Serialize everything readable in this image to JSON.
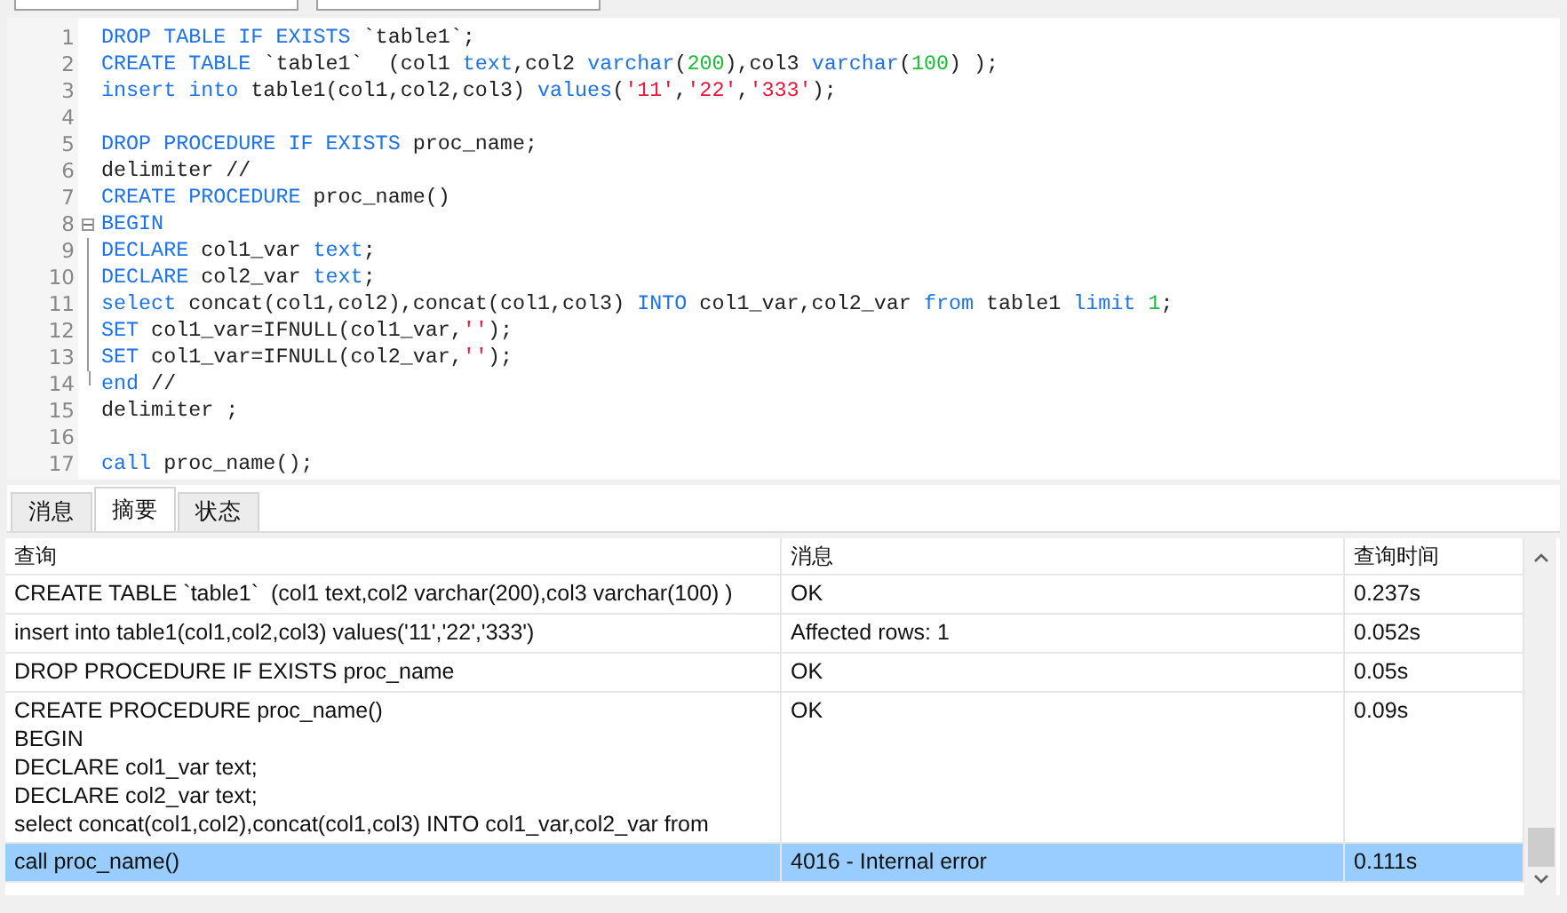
{
  "editor": {
    "lines": [
      {
        "number": "1",
        "tokens": [
          {
            "kind": "kw",
            "text": "DROP TABLE IF EXISTS"
          },
          {
            "kind": "plain",
            "text": " `table1`;"
          }
        ]
      },
      {
        "number": "2",
        "tokens": [
          {
            "kind": "kw",
            "text": "CREATE TABLE"
          },
          {
            "kind": "plain",
            "text": " `table1`  (col1 "
          },
          {
            "kind": "kw",
            "text": "text"
          },
          {
            "kind": "plain",
            "text": ",col2 "
          },
          {
            "kind": "kw",
            "text": "varchar"
          },
          {
            "kind": "plain",
            "text": "("
          },
          {
            "kind": "num",
            "text": "200"
          },
          {
            "kind": "plain",
            "text": "),col3 "
          },
          {
            "kind": "kw",
            "text": "varchar"
          },
          {
            "kind": "plain",
            "text": "("
          },
          {
            "kind": "num",
            "text": "100"
          },
          {
            "kind": "plain",
            "text": ") );"
          }
        ]
      },
      {
        "number": "3",
        "tokens": [
          {
            "kind": "kw",
            "text": "insert into"
          },
          {
            "kind": "plain",
            "text": " table1(col1,col2,col3) "
          },
          {
            "kind": "kw",
            "text": "values"
          },
          {
            "kind": "plain",
            "text": "("
          },
          {
            "kind": "str",
            "text": "'11'"
          },
          {
            "kind": "plain",
            "text": ","
          },
          {
            "kind": "str",
            "text": "'22'"
          },
          {
            "kind": "plain",
            "text": ","
          },
          {
            "kind": "str",
            "text": "'333'"
          },
          {
            "kind": "plain",
            "text": ");"
          }
        ]
      },
      {
        "number": "4"
      },
      {
        "number": "5",
        "tokens": [
          {
            "kind": "kw",
            "text": "DROP PROCEDURE IF EXISTS"
          },
          {
            "kind": "plain",
            "text": " proc_name;"
          }
        ]
      },
      {
        "number": "6",
        "tokens": [
          {
            "kind": "plain",
            "text": "delimiter //"
          }
        ]
      },
      {
        "number": "7",
        "tokens": [
          {
            "kind": "kw",
            "text": "CREATE PROCEDURE"
          },
          {
            "kind": "plain",
            "text": " proc_name()"
          }
        ]
      },
      {
        "number": "8",
        "expanded": true,
        "tokens": [
          {
            "kind": "kw",
            "text": "BEGIN"
          }
        ],
        "children": [
          {
            "number": "9",
            "tokens": [
              {
                "kind": "kw",
                "text": "DECLARE"
              },
              {
                "kind": "plain",
                "text": " col1_var "
              },
              {
                "kind": "kw",
                "text": "text"
              },
              {
                "kind": "plain",
                "text": ";"
              }
            ]
          },
          {
            "number": "10",
            "tokens": [
              {
                "kind": "kw",
                "text": "DECLARE"
              },
              {
                "kind": "plain",
                "text": " col2_var "
              },
              {
                "kind": "kw",
                "text": "text"
              },
              {
                "kind": "plain",
                "text": ";"
              }
            ]
          },
          {
            "number": "11",
            "tokens": [
              {
                "kind": "kw",
                "text": "select"
              },
              {
                "kind": "plain",
                "text": " concat(col1,col2),concat(col1,col3) "
              },
              {
                "kind": "kw",
                "text": "INTO"
              },
              {
                "kind": "plain",
                "text": " col1_var,col2_var "
              },
              {
                "kind": "kw",
                "text": "from"
              },
              {
                "kind": "plain",
                "text": " table1 "
              },
              {
                "kind": "kw",
                "text": "limit"
              },
              {
                "kind": "num",
                "text": " 1"
              },
              {
                "kind": "plain",
                "text": ";"
              }
            ]
          },
          {
            "number": "12",
            "tokens": [
              {
                "kind": "kw",
                "text": "SET"
              },
              {
                "kind": "plain",
                "text": " col1_var=IFNULL(col1_var,"
              },
              {
                "kind": "str",
                "text": "''"
              },
              {
                "kind": "plain",
                "text": ");"
              }
            ]
          },
          {
            "number": "13",
            "tokens": [
              {
                "kind": "kw",
                "text": "SET"
              },
              {
                "kind": "plain",
                "text": " col1_var=IFNULL(col2_var,"
              },
              {
                "kind": "str",
                "text": "''"
              },
              {
                "kind": "plain",
                "text": ");"
              }
            ]
          },
          {
            "number": "14",
            "tokens": [
              {
                "kind": "kw",
                "text": "end"
              },
              {
                "kind": "plain",
                "text": " //"
              }
            ]
          }
        ]
      },
      {
        "number": "15",
        "tokens": [
          {
            "kind": "plain",
            "text": "delimiter ;"
          }
        ]
      },
      {
        "number": "16"
      },
      {
        "number": "17",
        "tokens": [
          {
            "kind": "kw",
            "text": "call"
          },
          {
            "kind": "plain",
            "text": " proc_name();"
          }
        ]
      }
    ]
  },
  "tabs": [
    {
      "label": "消息",
      "selected": false
    },
    {
      "label": "摘要",
      "selected": true
    },
    {
      "label": "状态",
      "selected": false
    }
  ],
  "table": {
    "columns": [
      "查询",
      "消息",
      "查询时间"
    ],
    "rows": [
      {
        "query": [
          "CREATE TABLE `table1`  (col1 text,col2 varchar(200),col3 varchar(100) )"
        ],
        "message": "OK",
        "time": "0.237s",
        "selected": false
      },
      {
        "query": [
          "insert into table1(col1,col2,col3) values('11','22','333')"
        ],
        "message": "Affected rows: 1",
        "time": "0.052s",
        "selected": false
      },
      {
        "query": [
          "DROP PROCEDURE IF EXISTS proc_name"
        ],
        "message": "OK",
        "time": "0.05s",
        "selected": false
      },
      {
        "query": [
          "CREATE PROCEDURE proc_name()",
          "BEGIN",
          "DECLARE col1_var text;",
          "DECLARE col2_var text;",
          "select concat(col1,col2),concat(col1,col3) INTO col1_var,col2_var from"
        ],
        "message": "OK",
        "time": "0.09s",
        "selected": false
      },
      {
        "query": [
          "call proc_name()"
        ],
        "message": "4016 - Internal error",
        "time": "0.111s",
        "selected": true
      }
    ]
  }
}
